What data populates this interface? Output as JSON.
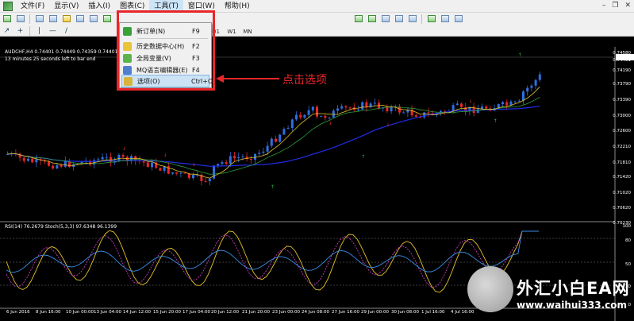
{
  "menubar": {
    "items": [
      "文件(F)",
      "显示(V)",
      "插入(I)",
      "图表(C)",
      "工具(T)",
      "窗口(W)",
      "帮助(H)"
    ]
  },
  "timeframes": [
    "H4",
    "D1",
    "W1",
    "MN"
  ],
  "chart": {
    "title": "AUDCHF,H4  0.74401 0.74449 0.74359 0.74401",
    "subtitle": "13 minutes 25 seconds left to bar end",
    "indicator_title": "RSI(14) 76.2679  Stoch(5,3,3) 97.6348 96.1399",
    "price_labels": [
      "0.74580",
      "0.74401",
      "0.74190",
      "0.73790",
      "0.73390",
      "0.73000",
      "0.72600",
      "0.72210",
      "0.71810",
      "0.71420",
      "0.71020",
      "0.70620",
      "0.70230"
    ],
    "indicator_labels": [
      "100",
      "80",
      "50",
      "20",
      "0"
    ],
    "time_labels": [
      "6 Jun 2016",
      "8 Jun 16:00",
      "10 Jun 00:00",
      "13 Jun 04:00",
      "14 Jun 12:00",
      "15 Jun 20:00",
      "17 Jun 04:00",
      "20 Jun 12:00",
      "21 Jun 20:00",
      "23 Jun 00:00",
      "24 Jun 08:00",
      "27 Jun 16:00",
      "29 Jun 00:00",
      "30 Jun 08:00",
      "1 Jul 16:00",
      "4 Jul 16:00"
    ]
  },
  "tools_menu": {
    "items": [
      {
        "label": "新订单(N)",
        "shortcut": "F9"
      },
      {
        "label": "历史数据中心(H)",
        "shortcut": "F2"
      },
      {
        "label": "全局变量(V)",
        "shortcut": "F3"
      },
      {
        "label": "MQ语言编辑器(E)",
        "shortcut": "F4"
      },
      {
        "label": "选项(O)",
        "shortcut": "Ctrl+O"
      }
    ]
  },
  "annotation": "点击选项",
  "watermark": {
    "title": "外汇小白EA网",
    "url": "www.waihui333.com"
  },
  "colors": {
    "highlight": "#e8262a",
    "bull": "#2f6fe0",
    "bear": "#e8262a",
    "ma_blue": "#1f2ee8"
  }
}
